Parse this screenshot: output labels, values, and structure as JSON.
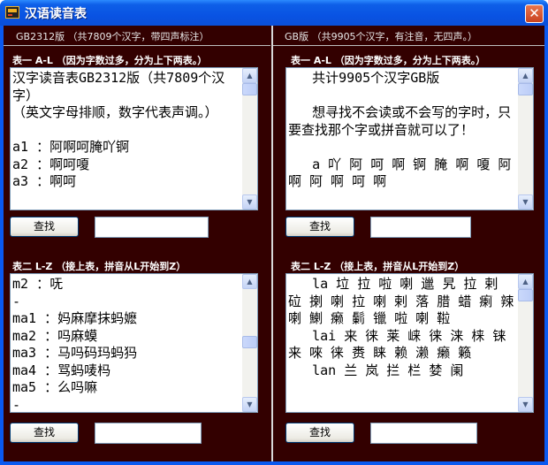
{
  "window": {
    "title": "汉语读音表",
    "close_glyph": "✕"
  },
  "left": {
    "header": "GB2312版 （共7809个汉字，带四声标注）",
    "table1": {
      "label": "表一 A-L （因为字数过多，分为上下两表。）",
      "text": "汉字读音表GB2312版（共7809个汉字）\n（英文字母排顺，数字代表声调。）\n\na1 ：阿啊呵腌吖锕\na2 ：啊呵嗄\na3 ：啊呵",
      "button": "查找",
      "input_value": ""
    },
    "table2": {
      "label": "表二 L-Z （接上表，拼音从L开始到Z）",
      "text": "m2 ：呒\n-\nma1 ：妈麻摩抹蚂嬷\nma2 ：吗麻蟆\nma3 ：马吗码玛蚂犸\nma4 ：骂蚂唛杩\nma5 ：么吗嘛\n-",
      "button": "查找",
      "input_value": ""
    }
  },
  "right": {
    "header": "GB版 （共9905个汉字，有注音，无四声。）",
    "table1": {
      "label": "表一 A-L （因为字数过多，分为上下两表。）",
      "text": "   共计9905个汉字GB版\n\n   想寻找不会读或不会写的字时，只要查找那个字或拼音就可以了！\n\n   a 吖 阿 呵 啊 锕 腌 啊 嗄 阿 啊 阿 啊 呵 啊",
      "button": "查找",
      "input_value": ""
    },
    "table2": {
      "label": "表二 L-Z （接上表，拼音从L开始到Z）",
      "text": "   la 垃 拉 啦 喇 邋 旯 拉 剌 砬 揦 喇 拉 喇 剌 落 腊 蜡 瘌 辣 喇 鯻 癞 鬎 镴 啦 喇 鞡\n   lai 来 徕 莱 崃 徕 涞 梾 铼 来 唻 徕 赉 睐 赖 濑 癞 籁\n   lan 兰 岚 拦 栏 婪 阑",
      "button": "查找",
      "input_value": ""
    }
  }
}
